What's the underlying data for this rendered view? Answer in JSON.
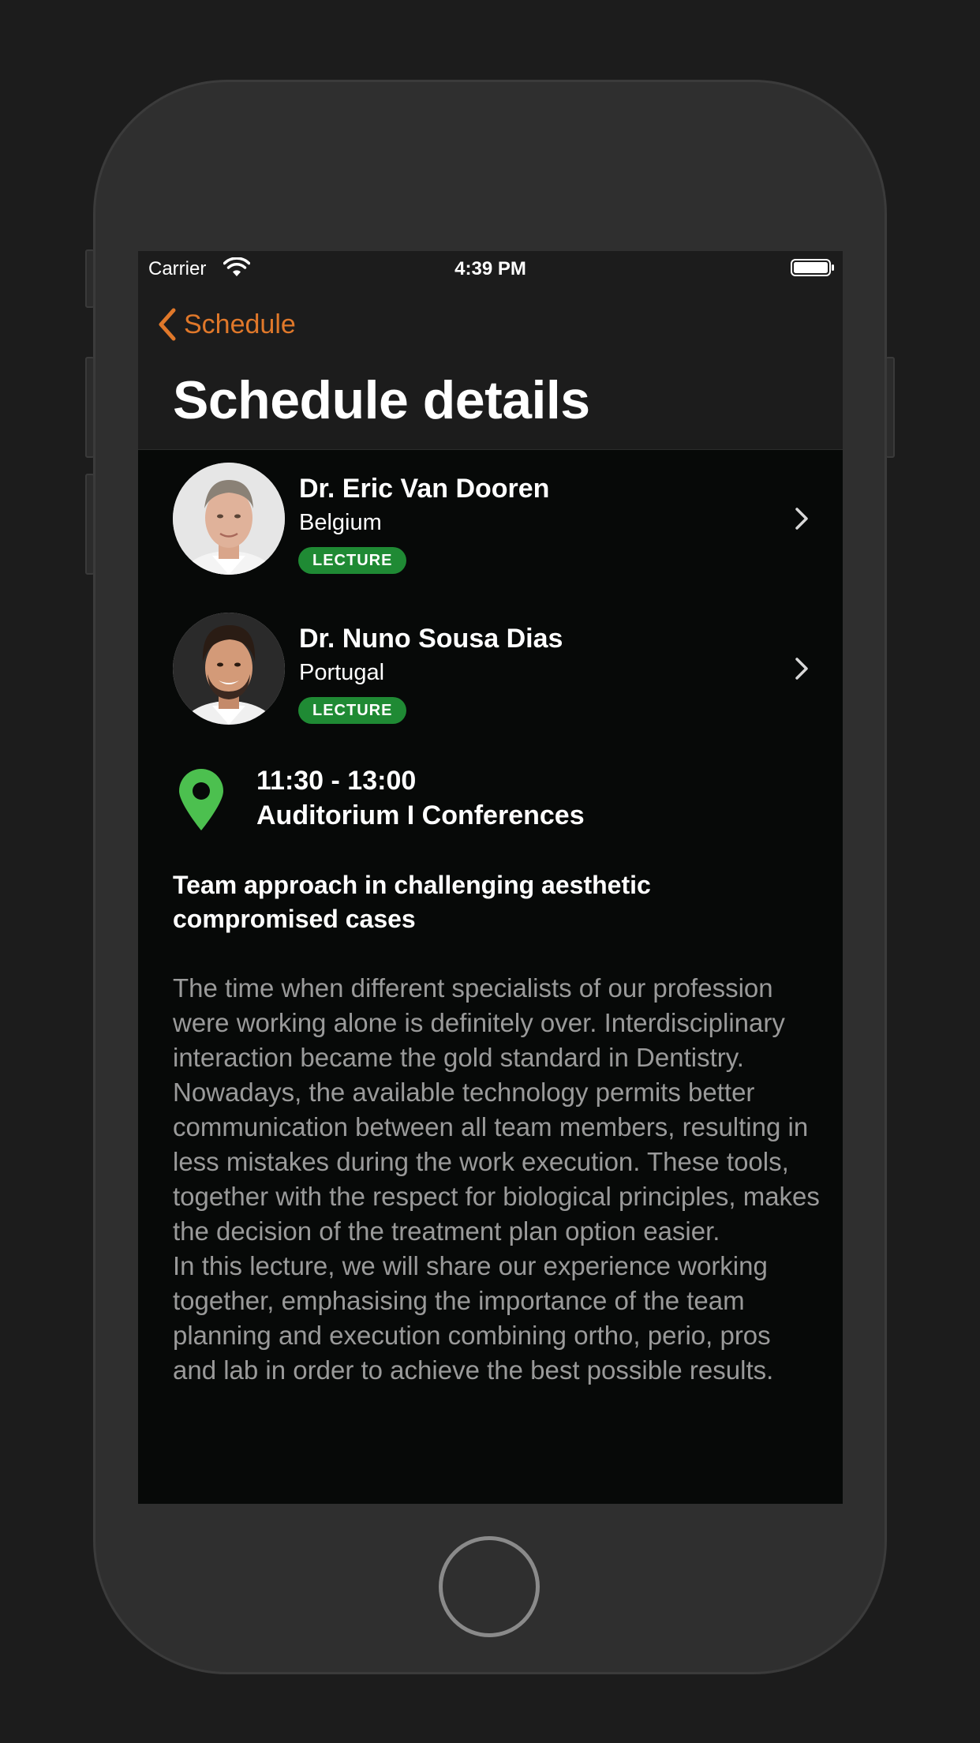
{
  "status_bar": {
    "carrier": "Carrier",
    "time": "4:39 PM"
  },
  "nav": {
    "back_label": "Schedule",
    "title": "Schedule details"
  },
  "speakers": [
    {
      "name": "Dr. Eric Van Dooren",
      "country": "Belgium",
      "badge": "LECTURE",
      "avatar": "speaker-photo"
    },
    {
      "name": "Dr. Nuno Sousa Dias",
      "country": "Portugal",
      "badge": "LECTURE",
      "avatar": "speaker-photo"
    }
  ],
  "session": {
    "time": "11:30 - 13:00",
    "room": "Auditorium I Conferences",
    "icon": "location-pin-icon"
  },
  "talk": {
    "title": "Team approach in challenging aesthetic compromised cases",
    "description": "The time when different specialists of our profession were working alone is definitely over. Interdisciplinary interaction became the gold standard in Dentistry.\nNowadays, the available technology permits better communication between all team members, resulting in less mistakes during the work execution. These tools, together with the respect for biological principles, makes the decision of the treatment plan option easier.\nIn this lecture, we will share our experience working together, emphasising the importance of the team planning and execution combining ortho, perio, pros and lab in order to achieve the best possible results."
  },
  "colors": {
    "accent": "#e0782a",
    "badge": "#1f8a34",
    "pin": "#4cc04f",
    "nav_background": "#1c1c1c",
    "background": "#070908",
    "body_text": "#9a9a9a"
  }
}
